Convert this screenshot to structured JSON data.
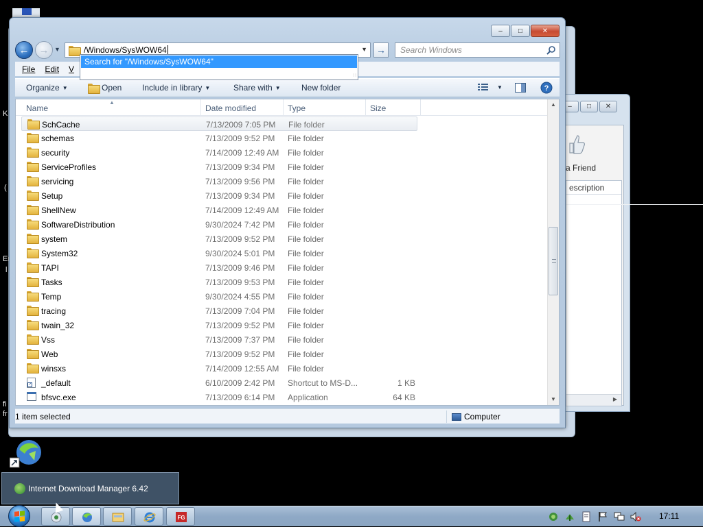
{
  "window": {
    "address_path": "/Windows/SysWOW64",
    "search_placeholder": "Search Windows",
    "suggestion": "Search for \"/Windows/SysWOW64\"",
    "menu": {
      "file": "File",
      "edit": "Edit",
      "view": "V"
    },
    "commands": {
      "organize": "Organize",
      "open": "Open",
      "include_in_library": "Include in library",
      "share_with": "Share with",
      "new_folder": "New folder"
    },
    "columns": {
      "name": "Name",
      "date_modified": "Date modified",
      "type": "Type",
      "size": "Size"
    },
    "files": [
      {
        "name": "SchCache",
        "date": "7/13/2009 7:05 PM",
        "type": "File folder",
        "size": "",
        "icon": "folder-icon",
        "selected": true
      },
      {
        "name": "schemas",
        "date": "7/13/2009 9:52 PM",
        "type": "File folder",
        "size": "",
        "icon": "folder-icon"
      },
      {
        "name": "security",
        "date": "7/14/2009 12:49 AM",
        "type": "File folder",
        "size": "",
        "icon": "folder-icon"
      },
      {
        "name": "ServiceProfiles",
        "date": "7/13/2009 9:34 PM",
        "type": "File folder",
        "size": "",
        "icon": "folder-icon"
      },
      {
        "name": "servicing",
        "date": "7/13/2009 9:56 PM",
        "type": "File folder",
        "size": "",
        "icon": "folder-icon"
      },
      {
        "name": "Setup",
        "date": "7/13/2009 9:34 PM",
        "type": "File folder",
        "size": "",
        "icon": "folder-icon"
      },
      {
        "name": "ShellNew",
        "date": "7/14/2009 12:49 AM",
        "type": "File folder",
        "size": "",
        "icon": "folder-icon"
      },
      {
        "name": "SoftwareDistribution",
        "date": "9/30/2024 7:42 PM",
        "type": "File folder",
        "size": "",
        "icon": "folder-icon"
      },
      {
        "name": "system",
        "date": "7/13/2009 9:52 PM",
        "type": "File folder",
        "size": "",
        "icon": "folder-icon"
      },
      {
        "name": "System32",
        "date": "9/30/2024 5:01 PM",
        "type": "File folder",
        "size": "",
        "icon": "folder-icon"
      },
      {
        "name": "TAPI",
        "date": "7/13/2009 9:46 PM",
        "type": "File folder",
        "size": "",
        "icon": "folder-icon"
      },
      {
        "name": "Tasks",
        "date": "7/13/2009 9:53 PM",
        "type": "File folder",
        "size": "",
        "icon": "folder-icon"
      },
      {
        "name": "Temp",
        "date": "9/30/2024 4:55 PM",
        "type": "File folder",
        "size": "",
        "icon": "folder-icon"
      },
      {
        "name": "tracing",
        "date": "7/13/2009 7:04 PM",
        "type": "File folder",
        "size": "",
        "icon": "folder-icon"
      },
      {
        "name": "twain_32",
        "date": "7/13/2009 9:52 PM",
        "type": "File folder",
        "size": "",
        "icon": "folder-icon"
      },
      {
        "name": "Vss",
        "date": "7/13/2009 7:37 PM",
        "type": "File folder",
        "size": "",
        "icon": "folder-icon"
      },
      {
        "name": "Web",
        "date": "7/13/2009 9:52 PM",
        "type": "File folder",
        "size": "",
        "icon": "folder-icon"
      },
      {
        "name": "winsxs",
        "date": "7/14/2009 12:55 AM",
        "type": "File folder",
        "size": "",
        "icon": "folder-icon"
      },
      {
        "name": "_default",
        "date": "6/10/2009 2:42 PM",
        "type": "Shortcut to MS-D...",
        "size": "1 KB",
        "icon": "shortcut-icon"
      },
      {
        "name": "bfsvc.exe",
        "date": "7/13/2009 6:14 PM",
        "type": "Application",
        "size": "64 KB",
        "icon": "application-icon"
      }
    ],
    "status_left": "1 item selected",
    "status_right": "Computer"
  },
  "background_window": {
    "friend_label": "a Friend",
    "list_header": "escription"
  },
  "desktop": {
    "text_1": "fi",
    "text_2": "fr",
    "text_3": "Er",
    "text_4": "l",
    "text_5": "K",
    "text_6": "(",
    "tooltip": "Internet Download Manager 6.42"
  },
  "taskbar": {
    "clock": "17:11",
    "buttons": [
      "media-player-icon",
      "idm-icon",
      "explorer-icon",
      "internet-explorer-icon",
      "app-fg-icon"
    ]
  },
  "colors": {
    "selection": "#3399ff",
    "taskbar": "#8fa9c6"
  }
}
